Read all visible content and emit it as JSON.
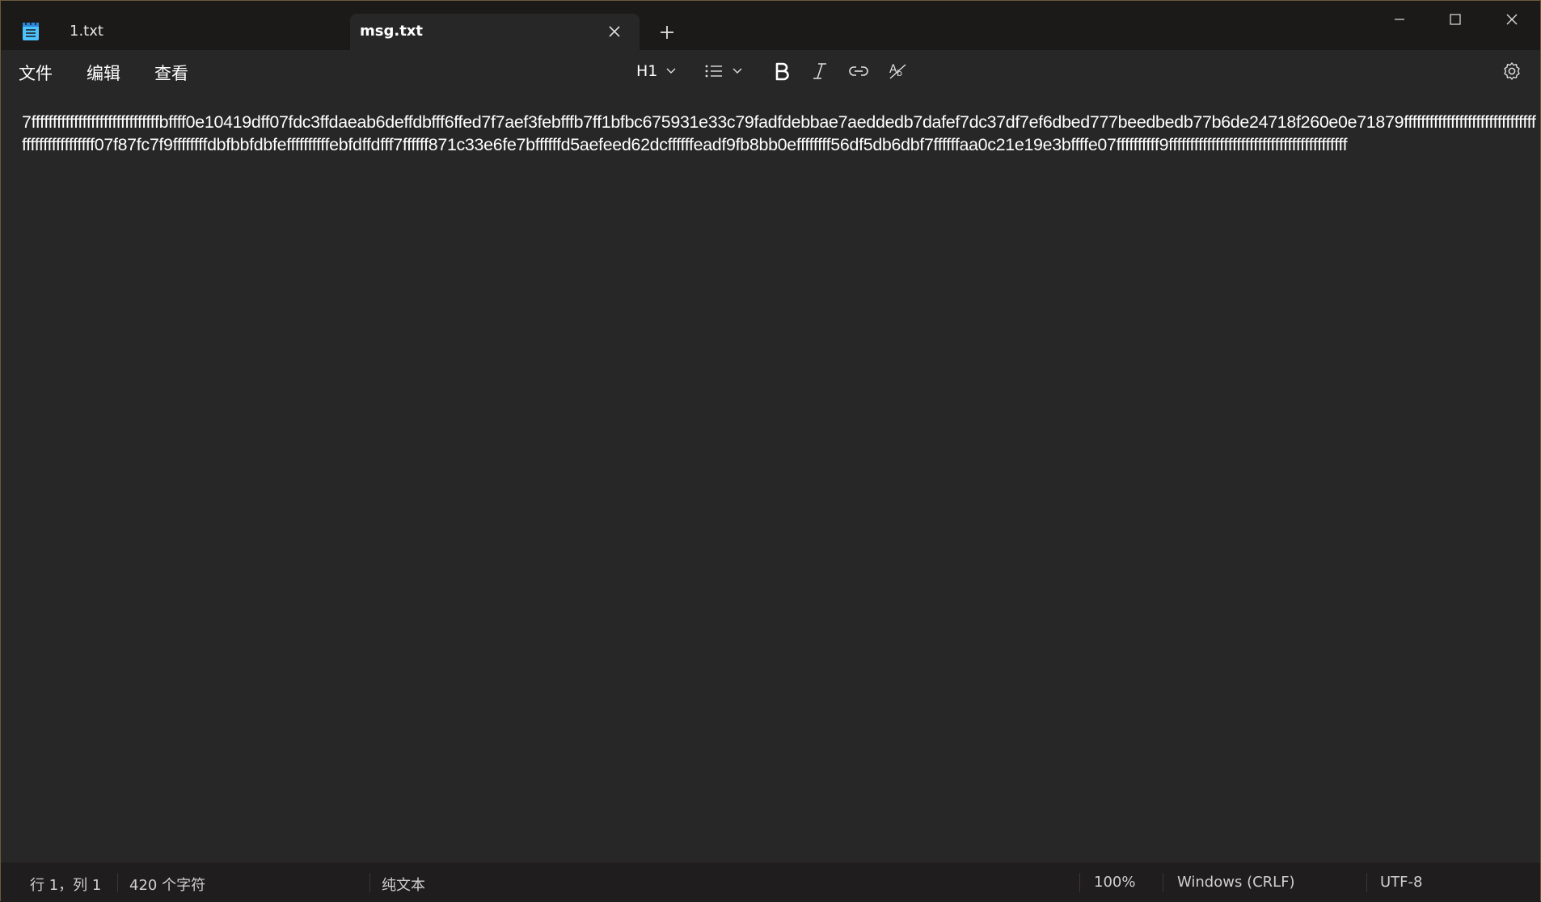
{
  "app": {
    "icon": "notepad-icon"
  },
  "tabs": [
    {
      "label": "1.txt",
      "active": false
    },
    {
      "label": "msg.txt",
      "active": true
    }
  ],
  "icons": {
    "tab_close": "close-icon",
    "new_tab": "plus-icon",
    "minimize": "minimize-icon",
    "maximize": "maximize-icon",
    "close": "close-icon",
    "list": "bulleted-list-icon",
    "bold": "bold-icon",
    "italic": "italic-icon",
    "link": "link-icon",
    "spellcheck": "spellcheck-icon",
    "settings": "gear-icon"
  },
  "menu": {
    "file": "文件",
    "edit": "编辑",
    "view": "查看"
  },
  "toolbar": {
    "heading": "H1"
  },
  "editor": {
    "content": "7ffffffffffffffffffffffffffffffbffff0e10419dff07fdc3ffdaeab6deffdbfff6ffed7f7aef3febfffb7ff1bfbc675931e33c79fadfdebbae7aeddedb7dafef7dc37df7ef6dbed777beedbedb77b6de24718f260e0e71879ffffffffffffffffffffffffffffffffffffffffffffffff07f87fc7f9ffffffffdbfbbfdbfeffffffffffebfdffdfff7ffffff871c33e6fe7bffffffd5aefeed62dcffffffeadf9fb8bb0effffffff56df5db6dbf7ffffffaa0c21e19e3bffffe07ffffffffff9ffffffffffffffffffffffffffffffffffffffffff"
  },
  "status": {
    "position": "行 1，列 1",
    "chars": "420 个字符",
    "format": "纯文本",
    "zoom": "100%",
    "line_ending": "Windows (CRLF)",
    "encoding": "UTF-8"
  },
  "colors": {
    "background": "#272727",
    "titlebar": "#1c1a19",
    "text": "#ffffff"
  }
}
